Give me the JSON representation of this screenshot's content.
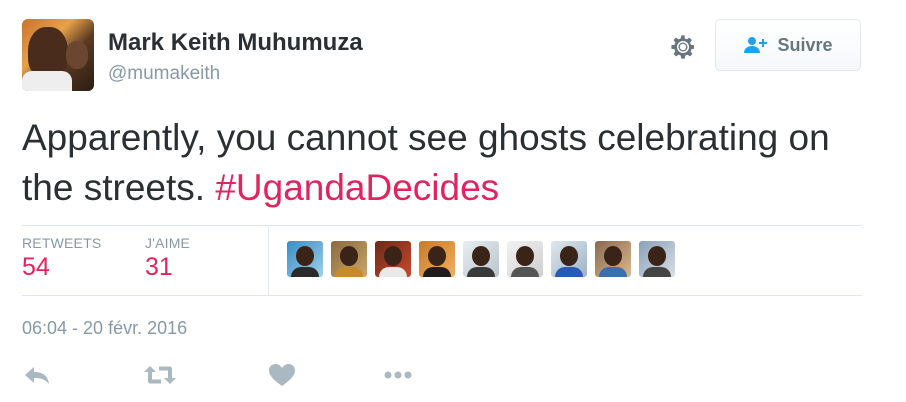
{
  "user": {
    "name": "Mark Keith Muhumuza",
    "handle": "@mumakeith"
  },
  "follow_button": {
    "label": "Suivre"
  },
  "tweet": {
    "text": "Apparently, you cannot see ghosts celebrating on the streets.",
    "hashtag": "#UgandaDecides"
  },
  "stats": {
    "retweets_label": "RETWEETS",
    "retweets_value": "54",
    "likes_label": "J'AIME",
    "likes_value": "31"
  },
  "likers_count_shown": 9,
  "timestamp": "06:04 - 20 févr. 2016",
  "colors": {
    "accent": "#e0245e",
    "muted": "#8899a6",
    "text": "#292f33",
    "border": "#e1e8ed"
  },
  "icons": {
    "settings": "gear-icon",
    "follow": "add-user-icon",
    "reply": "reply-icon",
    "retweet": "retweet-icon",
    "like": "heart-icon",
    "more": "more-icon"
  }
}
